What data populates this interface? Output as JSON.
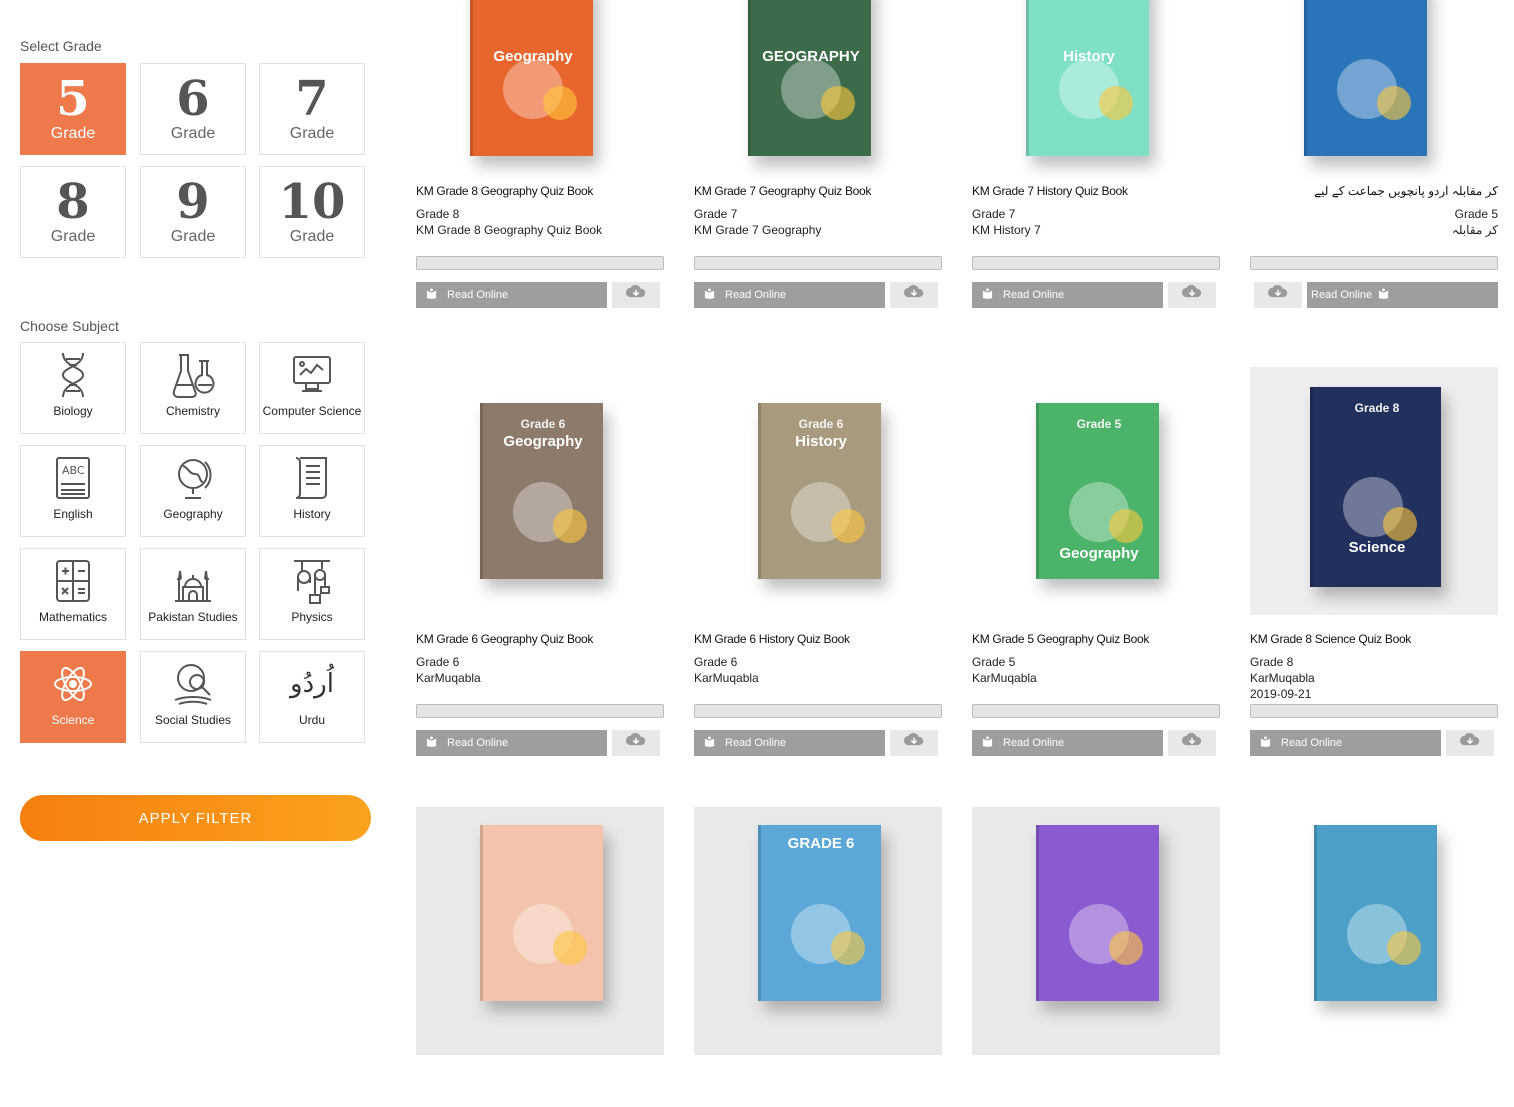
{
  "filters": {
    "grade_label": "Select Grade",
    "subject_label": "Choose Subject",
    "apply_label": "APPLY FILTER",
    "grade_word": "Grade",
    "grades": [
      {
        "num": "5",
        "active": true
      },
      {
        "num": "6",
        "active": false
      },
      {
        "num": "7",
        "active": false
      },
      {
        "num": "8",
        "active": false
      },
      {
        "num": "9",
        "active": false
      },
      {
        "num": "10",
        "active": false
      }
    ],
    "subjects": [
      {
        "label": "Biology",
        "icon": "dna-icon",
        "active": false
      },
      {
        "label": "Chemistry",
        "icon": "flask-icon",
        "active": false
      },
      {
        "label": "Computer Science",
        "icon": "computer-icon",
        "active": false
      },
      {
        "label": "English",
        "icon": "abc-book-icon",
        "active": false
      },
      {
        "label": "Geography",
        "icon": "globe-icon",
        "active": false
      },
      {
        "label": "History",
        "icon": "scroll-icon",
        "active": false
      },
      {
        "label": "Mathematics",
        "icon": "calculator-icon",
        "active": false
      },
      {
        "label": "Pakistan Studies",
        "icon": "mosque-icon",
        "active": false
      },
      {
        "label": "Physics",
        "icon": "pulley-icon",
        "active": false
      },
      {
        "label": "Science",
        "icon": "atom-icon",
        "active": true
      },
      {
        "label": "Social Studies",
        "icon": "globe-magnifier-icon",
        "active": false
      },
      {
        "label": "اُردُو",
        "icon": "urdu-script-icon",
        "active": false,
        "caption": "Urdu"
      }
    ]
  },
  "books": {
    "read_label": "Read Online",
    "download_icon": "cloud-download-icon",
    "items": [
      {
        "title": "KM Grade 8 Geography Quiz Book",
        "lines": [
          "Grade 8",
          "KM Grade 8 Geography Quiz Book"
        ],
        "cover_text": "Geography",
        "cover_color": "#e8662d"
      },
      {
        "title": "KM Grade 7 Geography Quiz Book",
        "lines": [
          "Grade 7",
          "KM Grade 7 Geography"
        ],
        "cover_text": "GEOGRAPHY",
        "cover_color": "#3c6b4a"
      },
      {
        "title": "KM Grade 7 History Quiz Book",
        "lines": [
          "Grade 7",
          "KM History 7"
        ],
        "cover_text": "History",
        "cover_color": "#7fe0c6"
      },
      {
        "title": "کر مقابلہ اردو پانچویں جماعت کے لیے",
        "lines": [
          "Grade 5",
          "کر مقابلہ"
        ],
        "rtl": true,
        "cover_text": "",
        "cover_color": "#2a74b8"
      },
      {
        "title": "KM Grade 6 Geography Quiz Book",
        "lines": [
          "Grade 6",
          "KarMuqabla"
        ],
        "cover_text": "Geography",
        "cover_sub": "Grade 6",
        "cover_color": "#8c7a6b"
      },
      {
        "title": "KM Grade 6 History Quiz Book",
        "lines": [
          "Grade 6",
          "KarMuqabla"
        ],
        "cover_text": "History",
        "cover_sub": "Grade 6",
        "cover_color": "#a89a7e"
      },
      {
        "title": "KM Grade 5 Geography Quiz Book",
        "lines": [
          "Grade 5",
          "KarMuqabla"
        ],
        "cover_text": "Geography",
        "cover_sub": "Grade 5",
        "cover_color": "#4bb36a"
      },
      {
        "title": "KM Grade 8 Science Quiz Book",
        "lines": [
          "Grade 8",
          "KarMuqabla",
          "2019-09-21"
        ],
        "cover_text": "Science",
        "cover_sub": "Grade 8",
        "cover_color": "#22305e"
      },
      {
        "title": "",
        "lines": [],
        "cover_text": "",
        "cover_color": "#f3c3ab"
      },
      {
        "title": "",
        "lines": [],
        "cover_text": "GRADE 6",
        "cover_color": "#5aa7d8"
      },
      {
        "title": "",
        "lines": [],
        "cover_text": "",
        "cover_color": "#8a5ad0"
      },
      {
        "title": "",
        "lines": [],
        "cover_text": "",
        "cover_color": "#4ca0c8"
      }
    ]
  }
}
